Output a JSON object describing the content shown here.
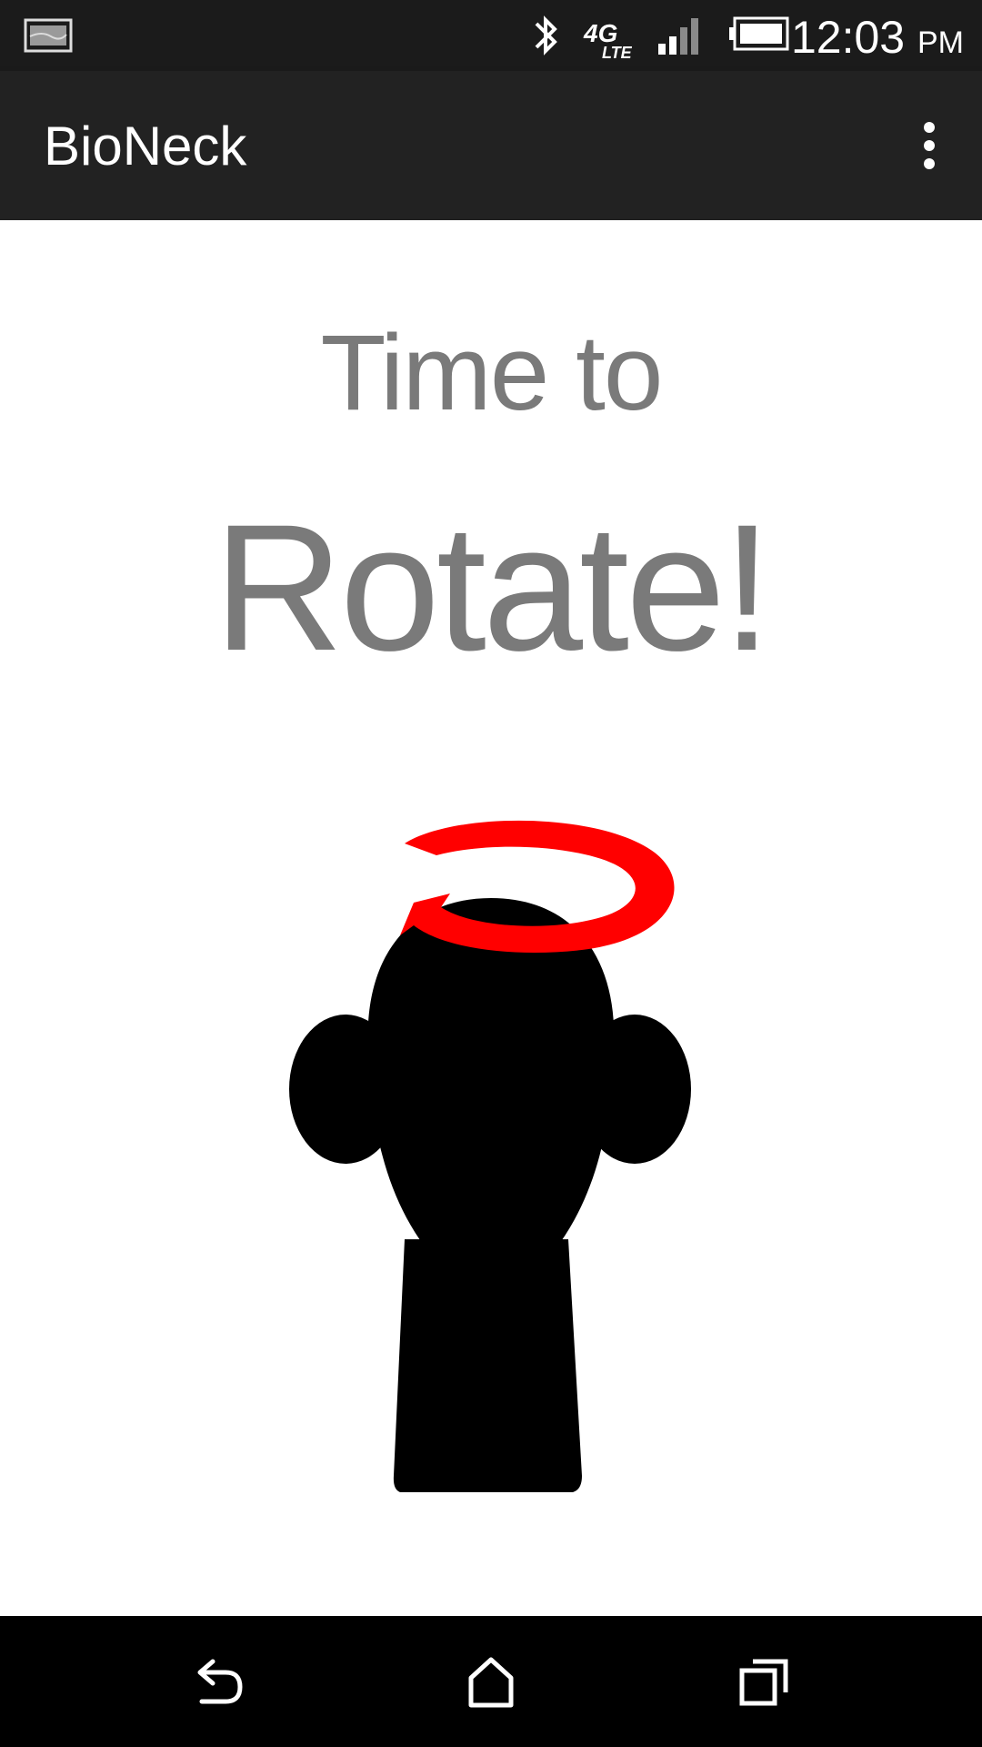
{
  "status_bar": {
    "time": "12:03",
    "ampm": "PM",
    "icons": [
      "notification-image-icon",
      "bluetooth-icon",
      "4g-lte-icon",
      "signal-icon",
      "battery-icon"
    ],
    "network_label": "4G LTE"
  },
  "app_bar": {
    "title": "BioNeck",
    "menu_icon": "overflow-menu-icon"
  },
  "main": {
    "line1": "Time to",
    "line2": "Rotate!",
    "illustration": {
      "icon": "head-rotate-icon",
      "colors": {
        "head": "#000000",
        "arrow": "#ff0000"
      }
    }
  },
  "nav_bar": {
    "buttons": [
      "back-icon",
      "home-icon",
      "recent-apps-icon"
    ]
  },
  "colors": {
    "status_bar_bg": "#1b1b1b",
    "app_bar_bg": "#222222",
    "text_gray": "#7a7a7a",
    "nav_bar_bg": "#000000"
  }
}
